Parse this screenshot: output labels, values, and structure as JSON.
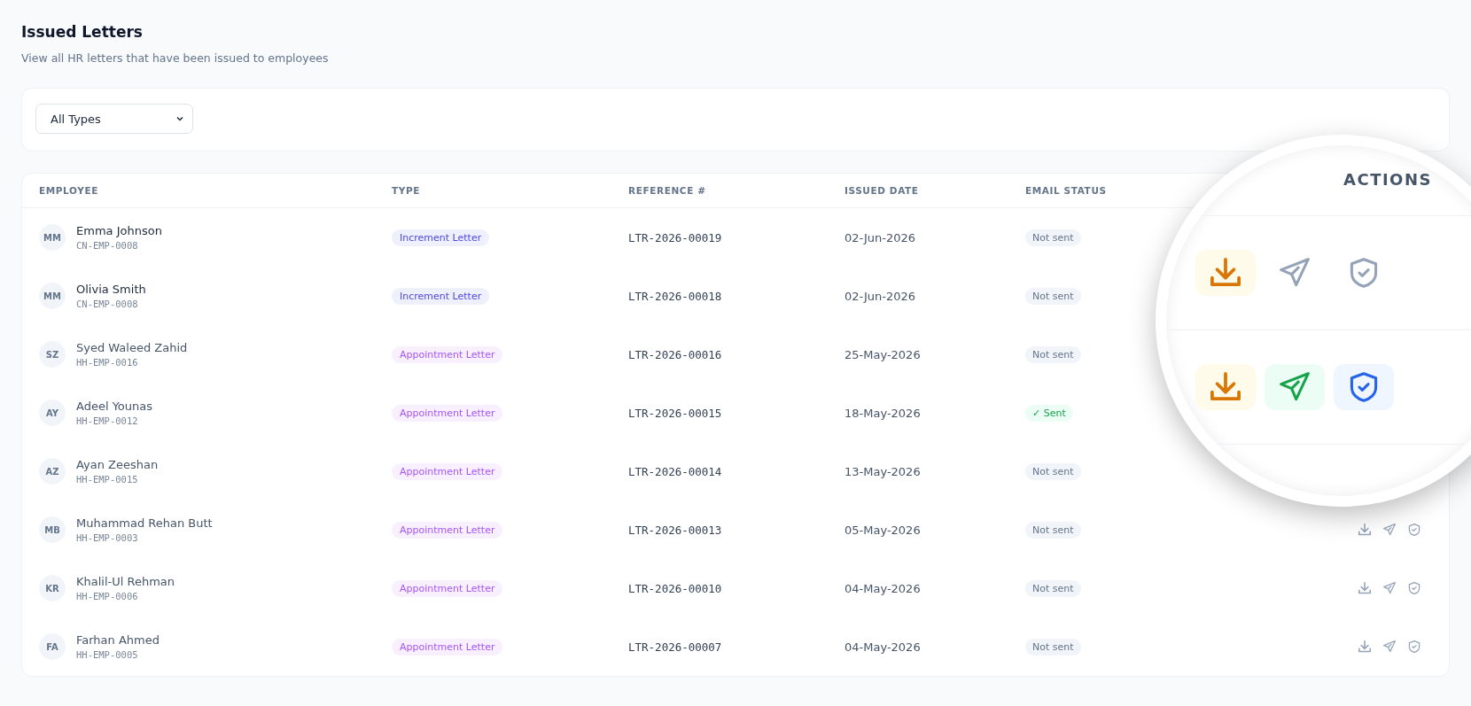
{
  "header": {
    "title": "Issued Letters",
    "subtitle": "View all HR letters that have been issued to employees"
  },
  "filter": {
    "value": "All Types"
  },
  "table": {
    "columns": [
      "EMPLOYEE",
      "TYPE",
      "REFERENCE #",
      "ISSUED DATE",
      "EMAIL STATUS"
    ],
    "rows": [
      {
        "initials": "MM",
        "name": "Emma Johnson",
        "code": "CN-EMP-0008",
        "type": "Increment Letter",
        "kind": "increment",
        "reference": "LTR-2026-00019",
        "date": "02-Jun-2026",
        "status": "Not sent",
        "sent": false,
        "blurred": false
      },
      {
        "initials": "MM",
        "name": "Olivia Smith",
        "code": "CN-EMP-0008",
        "type": "Increment Letter",
        "kind": "increment",
        "reference": "LTR-2026-00018",
        "date": "02-Jun-2026",
        "status": "Not sent",
        "sent": false,
        "blurred": false
      },
      {
        "initials": "SZ",
        "name": "Syed Waleed Zahid",
        "code": "HH-EMP-0016",
        "type": "Appointment Letter",
        "kind": "appointment",
        "reference": "LTR-2026-00016",
        "date": "25-May-2026",
        "status": "Not sent",
        "sent": false,
        "blurred": true
      },
      {
        "initials": "AY",
        "name": "Adeel Younas",
        "code": "HH-EMP-0012",
        "type": "Appointment Letter",
        "kind": "appointment",
        "reference": "LTR-2026-00015",
        "date": "18-May-2026",
        "status": "✓ Sent",
        "sent": true,
        "blurred": true
      },
      {
        "initials": "AZ",
        "name": "Ayan Zeeshan",
        "code": "HH-EMP-0015",
        "type": "Appointment Letter",
        "kind": "appointment",
        "reference": "LTR-2026-00014",
        "date": "13-May-2026",
        "status": "Not sent",
        "sent": false,
        "blurred": true
      },
      {
        "initials": "MB",
        "name": "Muhammad Rehan Butt",
        "code": "HH-EMP-0003",
        "type": "Appointment Letter",
        "kind": "appointment",
        "reference": "LTR-2026-00013",
        "date": "05-May-2026",
        "status": "Not sent",
        "sent": false,
        "blurred": true
      },
      {
        "initials": "KR",
        "name": "Khalil-Ul Rehman",
        "code": "HH-EMP-0006",
        "type": "Appointment Letter",
        "kind": "appointment",
        "reference": "LTR-2026-00010",
        "date": "04-May-2026",
        "status": "Not sent",
        "sent": false,
        "blurred": true
      },
      {
        "initials": "FA",
        "name": "Farhan Ahmed",
        "code": "HH-EMP-0005",
        "type": "Appointment Letter",
        "kind": "appointment",
        "reference": "LTR-2026-00007",
        "date": "04-May-2026",
        "status": "Not sent",
        "sent": false,
        "blurred": true
      }
    ]
  },
  "magnifier": {
    "heading": "ACTIONS",
    "rows": [
      {
        "sent": false
      },
      {
        "sent": true
      }
    ]
  }
}
